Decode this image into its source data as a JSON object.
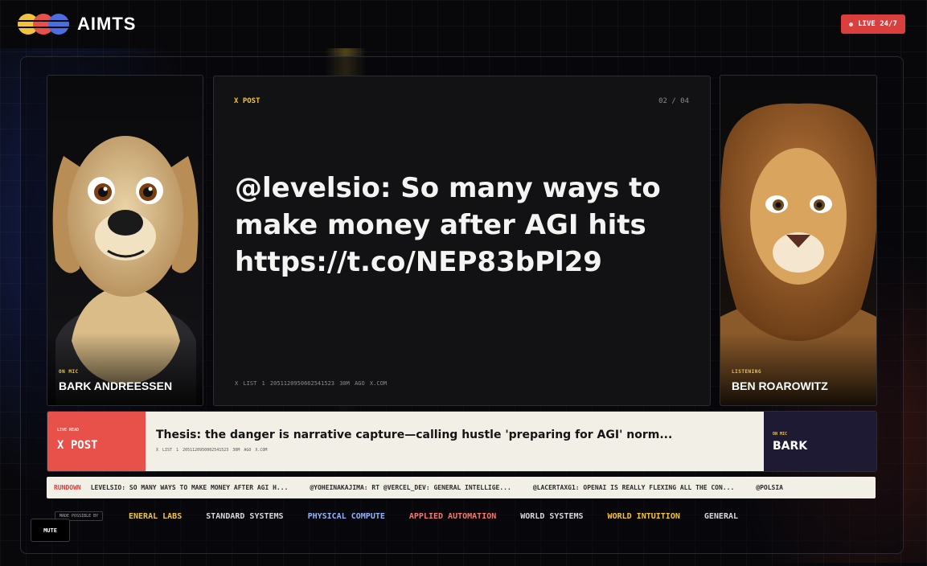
{
  "header": {
    "title": "AIMTS",
    "live_badge": "LIVE 24/7",
    "logo_colors": [
      "#f0c53b",
      "#e8504a",
      "#4a6ee0"
    ]
  },
  "hosts": {
    "left": {
      "status": "ON MIC",
      "name": "BARK ANDREESSEN",
      "icon": "dog-portrait"
    },
    "right": {
      "status": "LISTENING",
      "name": "BEN ROAROWITZ",
      "icon": "lion-portrait"
    }
  },
  "post": {
    "tag": "X POST",
    "counter": "02 / 04",
    "text": "@levelsio: So many ways to make money after AGI hits https://t.co/NEP83bPl29",
    "meta": "X LIST 1 2051120950662541523 30M AGO X.COM"
  },
  "live_read": {
    "label": "LIVE READ",
    "title": "X POST",
    "headline": "Thesis: the danger is narrative capture—calling hustle 'preparing for AGI' norm...",
    "meta": "X LIST 1 2051120950002541523 30M AGO X.COM",
    "speaker_label": "ON MIC",
    "speaker": "BARK"
  },
  "rundown": {
    "label": "RUNDOWN",
    "items": [
      "LEVELSIO: SO MANY WAYS TO MAKE MONEY AFTER AGI H...",
      "@YOHEINAKAJIMA: RT @VERCEL_DEV: GENERAL INTELLIGE...",
      "@LACERTAXG1: OPENAI IS REALLY FLEXING ALL THE CON...",
      "@POLSIA"
    ]
  },
  "sponsors": {
    "label": "MADE POSSIBLE BY",
    "items": [
      {
        "name": "ENERAL LABS",
        "color": "#f0c53b"
      },
      {
        "name": "STANDARD SYSTEMS",
        "color": "#d8d8d8"
      },
      {
        "name": "PHYSICAL COMPUTE",
        "color": "#8fb3ff"
      },
      {
        "name": "APPLIED AUTOMATION",
        "color": "#f07a72"
      },
      {
        "name": "WORLD SYSTEMS",
        "color": "#d8d8d8"
      },
      {
        "name": "WORLD INTUITION",
        "color": "#f0c53b"
      },
      {
        "name": "GENERAL",
        "color": "#d8d8d8"
      }
    ]
  },
  "controls": {
    "mute": "MUTE"
  }
}
